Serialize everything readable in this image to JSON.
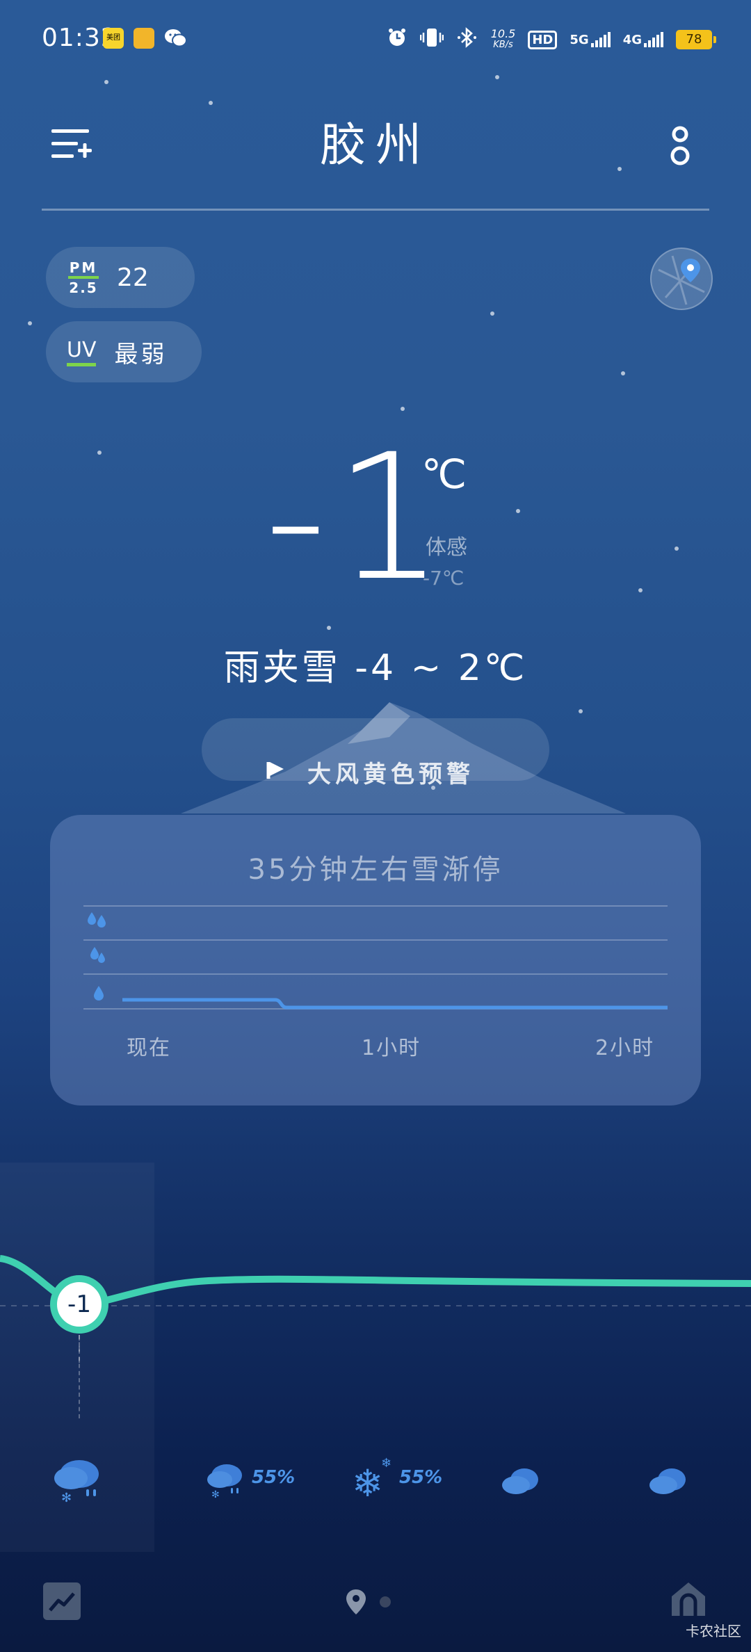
{
  "status_bar": {
    "time": "01:32",
    "app_badges": [
      "美团",
      "",
      ""
    ],
    "net_speed_value": "10.5",
    "net_speed_unit": "KB/s",
    "hd_label": "HD",
    "sim1_label": "5G",
    "sim2_label": "4G",
    "battery": "78"
  },
  "header": {
    "city": "胶州"
  },
  "air": {
    "pm_top": "PM",
    "pm_bottom": "2.5",
    "pm_value": "22",
    "uv_label": "UV",
    "uv_value": "最弱"
  },
  "current": {
    "temperature": "-1",
    "unit": "℃",
    "feels_like_label": "体感",
    "feels_like_value": "-7℃",
    "condition_range": "雨夹雪  -4 ~ 2℃"
  },
  "warning": {
    "text": "大风黄色预警"
  },
  "precip_card": {
    "title": "35分钟左右雪渐停",
    "axis_labels": [
      "现在",
      "1小时",
      "2小时"
    ]
  },
  "hourly": {
    "current_temp": "-1",
    "precip_chances": [
      "",
      "55%",
      "55%",
      "",
      ""
    ],
    "icons": [
      "sleet-icon",
      "sleet-icon",
      "snow-icon",
      "cloud-icon",
      "cloud-icon"
    ]
  },
  "footer": {
    "watermark": "卡农社区"
  },
  "colors": {
    "accent_teal": "#3fd0b0",
    "precip_blue": "#4d95e8",
    "good_green": "#7ed44a",
    "battery_yellow": "#f4c21a"
  }
}
